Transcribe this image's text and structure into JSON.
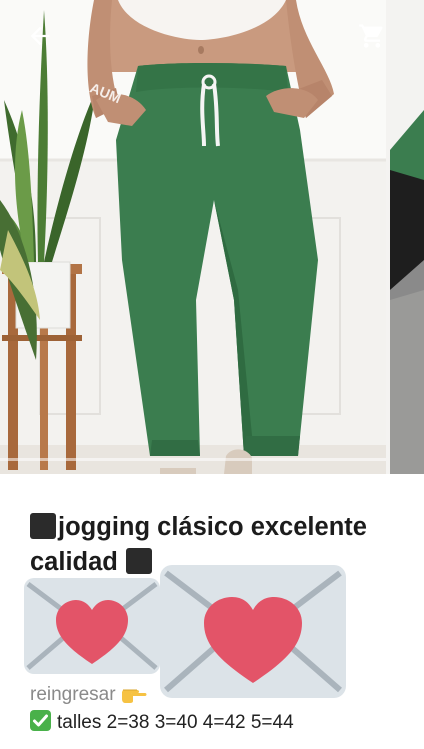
{
  "product": {
    "title": "jogging clásico excelente calidad"
  },
  "description": {
    "line1": "reingresar",
    "line2": "talles 2=38 3=40 4=42 5=44"
  },
  "icons": {
    "back": "arrow-left-icon",
    "cart": "cart-icon",
    "title_emoji": "black-square-icon",
    "envelope": "envelope-heart-icon",
    "pointing": "pointing-hand-icon",
    "check": "check-box-icon"
  },
  "colors": {
    "pants": "#3b7d4f",
    "check": "#49b14a",
    "heart": "#e35468",
    "envelope": "#dce3e8"
  }
}
